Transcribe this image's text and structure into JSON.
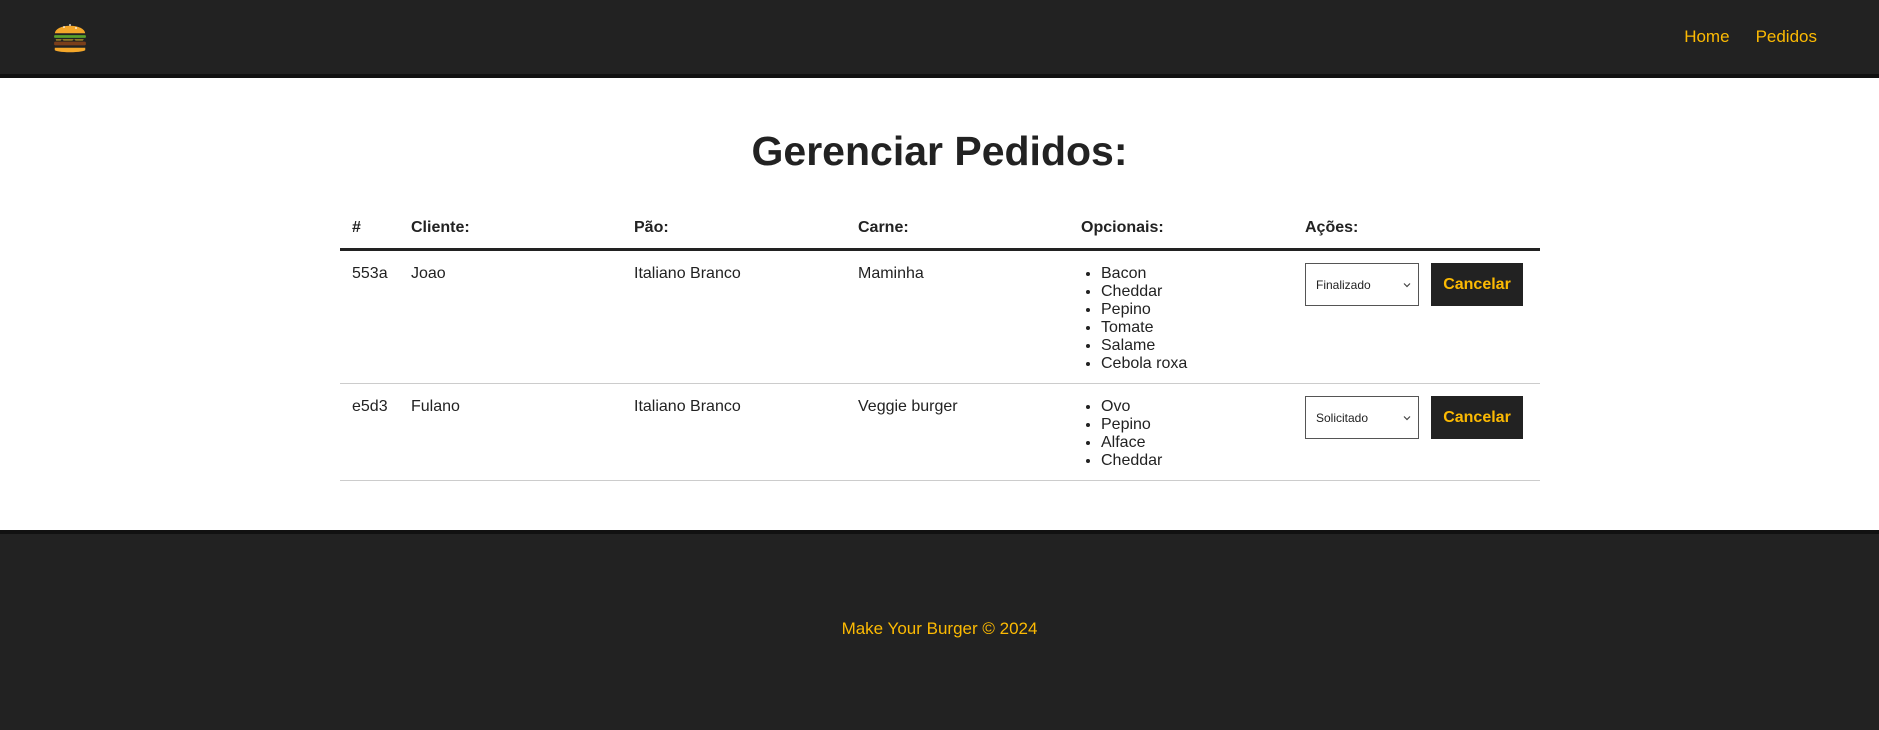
{
  "nav": {
    "logo_icon": "burger-icon",
    "links": [
      {
        "label": "Home"
      },
      {
        "label": "Pedidos"
      }
    ]
  },
  "page": {
    "title": "Gerenciar Pedidos:"
  },
  "table": {
    "headers": {
      "id": "#",
      "cliente": "Cliente:",
      "pao": "Pão:",
      "carne": "Carne:",
      "opcionais": "Opcionais:",
      "acoes": "Ações:"
    },
    "rows": [
      {
        "id": "553a",
        "cliente": "Joao",
        "pao": "Italiano Branco",
        "carne": "Maminha",
        "opcionais": [
          "Bacon",
          "Cheddar",
          "Pepino",
          "Tomate",
          "Salame",
          "Cebola roxa"
        ],
        "status": "Finalizado",
        "cancel_label": "Cancelar"
      },
      {
        "id": "e5d3",
        "cliente": "Fulano",
        "pao": "Italiano Branco",
        "carne": "Veggie burger",
        "opcionais": [
          "Ovo",
          "Pepino",
          "Alface",
          "Cheddar"
        ],
        "status": "Solicitado",
        "cancel_label": "Cancelar"
      }
    ]
  },
  "footer": {
    "text": "Make Your Burger © 2024"
  },
  "colors": {
    "background_dark": "#222222",
    "accent": "#fcba03"
  }
}
